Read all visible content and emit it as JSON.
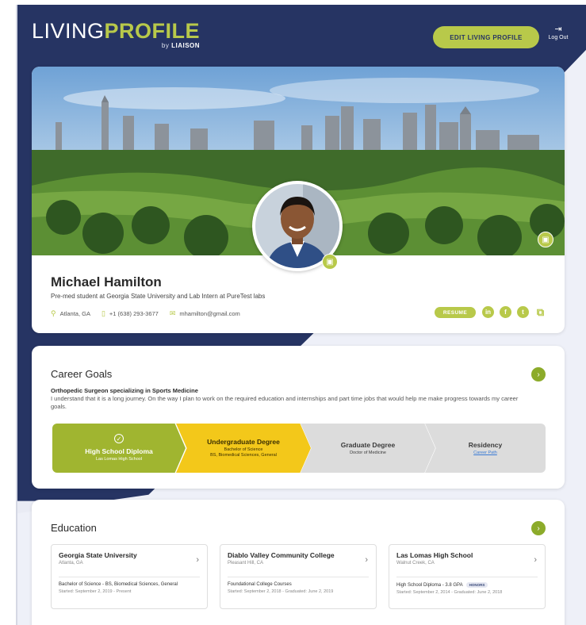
{
  "header": {
    "logo_living": "LIVING",
    "logo_profile": "PROFILE",
    "logo_by": "by",
    "logo_brand": "LIAISON",
    "edit_button": "EDIT LIVING PROFILE",
    "logout_label": "Log Out"
  },
  "profile": {
    "name": "Michael Hamilton",
    "headline": "Pre-med student at Georgia State University and Lab Intern at PureTest labs",
    "location": "Atlanta, GA",
    "phone": "+1 (638) 293-3677",
    "email": "mhamilton@gmail.com",
    "resume_label": "RESUME",
    "socials": [
      "linkedin-icon",
      "facebook-icon",
      "twitter-icon",
      "external-link-icon"
    ]
  },
  "career_goals": {
    "title": "Career Goals",
    "goal_title": "Orthopedic Surgeon specializing in Sports Medicine",
    "goal_desc": "I understand that it is a long journey. On the way I plan to work on the required education and internships and part time jobs that would help me make progress towards my career goals.",
    "steps": [
      {
        "title": "High School Diploma",
        "sub1": "Las Lomas High School",
        "sub2": "",
        "status": "complete"
      },
      {
        "title": "Undergraduate Degree",
        "sub1": "Bachelor of Science",
        "sub2": "BS, Biomedical Sciences, General",
        "status": "current"
      },
      {
        "title": "Graduate Degree",
        "sub1": "Doctor of Medicine",
        "sub2": "",
        "status": "future"
      },
      {
        "title": "Residency",
        "sub1": "Career Path",
        "sub2": "",
        "status": "future"
      }
    ]
  },
  "education": {
    "title": "Education",
    "schools": [
      {
        "name": "Georgia State University",
        "location": "Atlanta, GA",
        "degree": "Bachelor of Science - BS, Biomedical Sciences, General",
        "dates": "Started: September 2, 2019 - Present",
        "badge": ""
      },
      {
        "name": "Diablo Valley Community College",
        "location": "Pleasant Hill, CA",
        "degree": "Foundational College Courses",
        "dates": "Started: September 2, 2018 - Graduated: June 2, 2019",
        "badge": ""
      },
      {
        "name": "Las Lomas High School",
        "location": "Walnut Creek, CA",
        "degree": "High School Diploma - 3.8 GPA",
        "dates": "Started: September 2, 2014 - Graduated: June 2, 2018",
        "badge": "HONORS"
      }
    ]
  },
  "colors": {
    "navy": "#263463",
    "accent_green": "#b8c94a",
    "step_yellow": "#f3c81a"
  }
}
